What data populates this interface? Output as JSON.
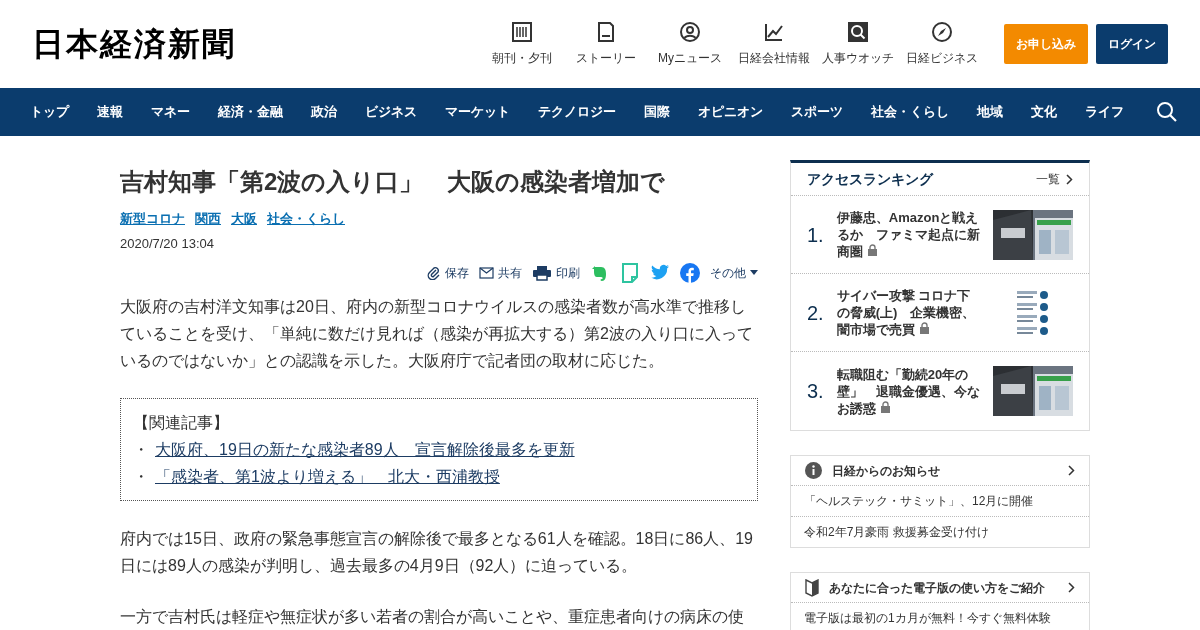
{
  "header": {
    "logo": "日本経済新聞",
    "services": [
      {
        "kind": "paper",
        "label": "朝刊・夕刊"
      },
      {
        "kind": "story",
        "label": "ストーリー"
      },
      {
        "kind": "person",
        "label": "Myニュース"
      },
      {
        "kind": "chart",
        "label": "日経会社情報"
      },
      {
        "kind": "search",
        "label": "人事ウオッチ"
      },
      {
        "kind": "compass",
        "label": "日経ビジネス"
      }
    ],
    "buttons": [
      {
        "kind": "apply",
        "label": "お申し込み"
      },
      {
        "kind": "login",
        "label": "ログイン"
      }
    ]
  },
  "nav": {
    "items": [
      "トップ",
      "速報",
      "マネー",
      "経済・金融",
      "政治",
      "ビジネス",
      "マーケット",
      "テクノロジー",
      "国際",
      "オピニオン",
      "スポーツ",
      "社会・くらし",
      "地域",
      "文化",
      "ライフ"
    ]
  },
  "article": {
    "title": "吉村知事「第2波の入り口」　大阪の感染者増加で",
    "tags": [
      "新型コロナ",
      "関西",
      "大阪",
      "社会・くらし"
    ],
    "date": "2020/7/20 13:04",
    "share": [
      {
        "kind": "save",
        "label": "保存"
      },
      {
        "kind": "mail",
        "label": "共有"
      },
      {
        "kind": "print",
        "label": "印刷"
      },
      {
        "kind": "evernote"
      },
      {
        "kind": "memo"
      },
      {
        "kind": "twitter"
      },
      {
        "kind": "facebook"
      },
      {
        "kind": "more",
        "label": "その他"
      }
    ],
    "lead": "大阪府の吉村洋文知事は20日、府内の新型コロナウイルスの感染者数が高水準で推移していることを受け、「単純に数だけ見れば（感染が再拡大する）第2波の入り口に入っているのではないか」との認識を示した。大阪府庁で記者団の取材に応じた。",
    "related": {
      "title": "【関連記事】",
      "bullet": "・",
      "links": [
        "大阪府、19日の新たな感染者89人　宣言解除後最多を更新",
        "「感染者、第1波より増える」　北大・西浦教授"
      ]
    },
    "paragraphs": [
      "府内では15日、政府の緊急事態宣言の解除後で最多となる61人を確認。18日に86人、19日には89人の感染が判明し、過去最多の4月9日（92人）に迫っている。",
      "一方で吉村氏は軽症や無症状が多い若者の割合が高いことや、重症患者向けの病床の使"
    ]
  },
  "ranking": {
    "title": "アクセスランキング",
    "more": "一覧",
    "items": [
      {
        "rank": "1.",
        "title": "伊藤忠、Amazonと戦えるか　ファミマ起点に新商圏",
        "locked": true
      },
      {
        "rank": "2.",
        "title": "サイバー攻撃 コロナ下の脅威(上)　企業機密、闇市場で売買",
        "locked": true
      },
      {
        "rank": "3.",
        "title": "転職阻む「勤続20年の壁」　退職金優遇、今なお誘惑",
        "locked": true
      }
    ]
  },
  "notices": {
    "title": "日経からのお知らせ",
    "items": [
      "「ヘルステック・サミット」、12月に開催",
      "令和2年7月豪雨 救援募金受け付け"
    ]
  },
  "guide": {
    "title": "あなたに合った電子版の使い方をご紹介",
    "items": [
      "電子版は最初の1カ月が無料！今すぐ無料体験"
    ]
  }
}
